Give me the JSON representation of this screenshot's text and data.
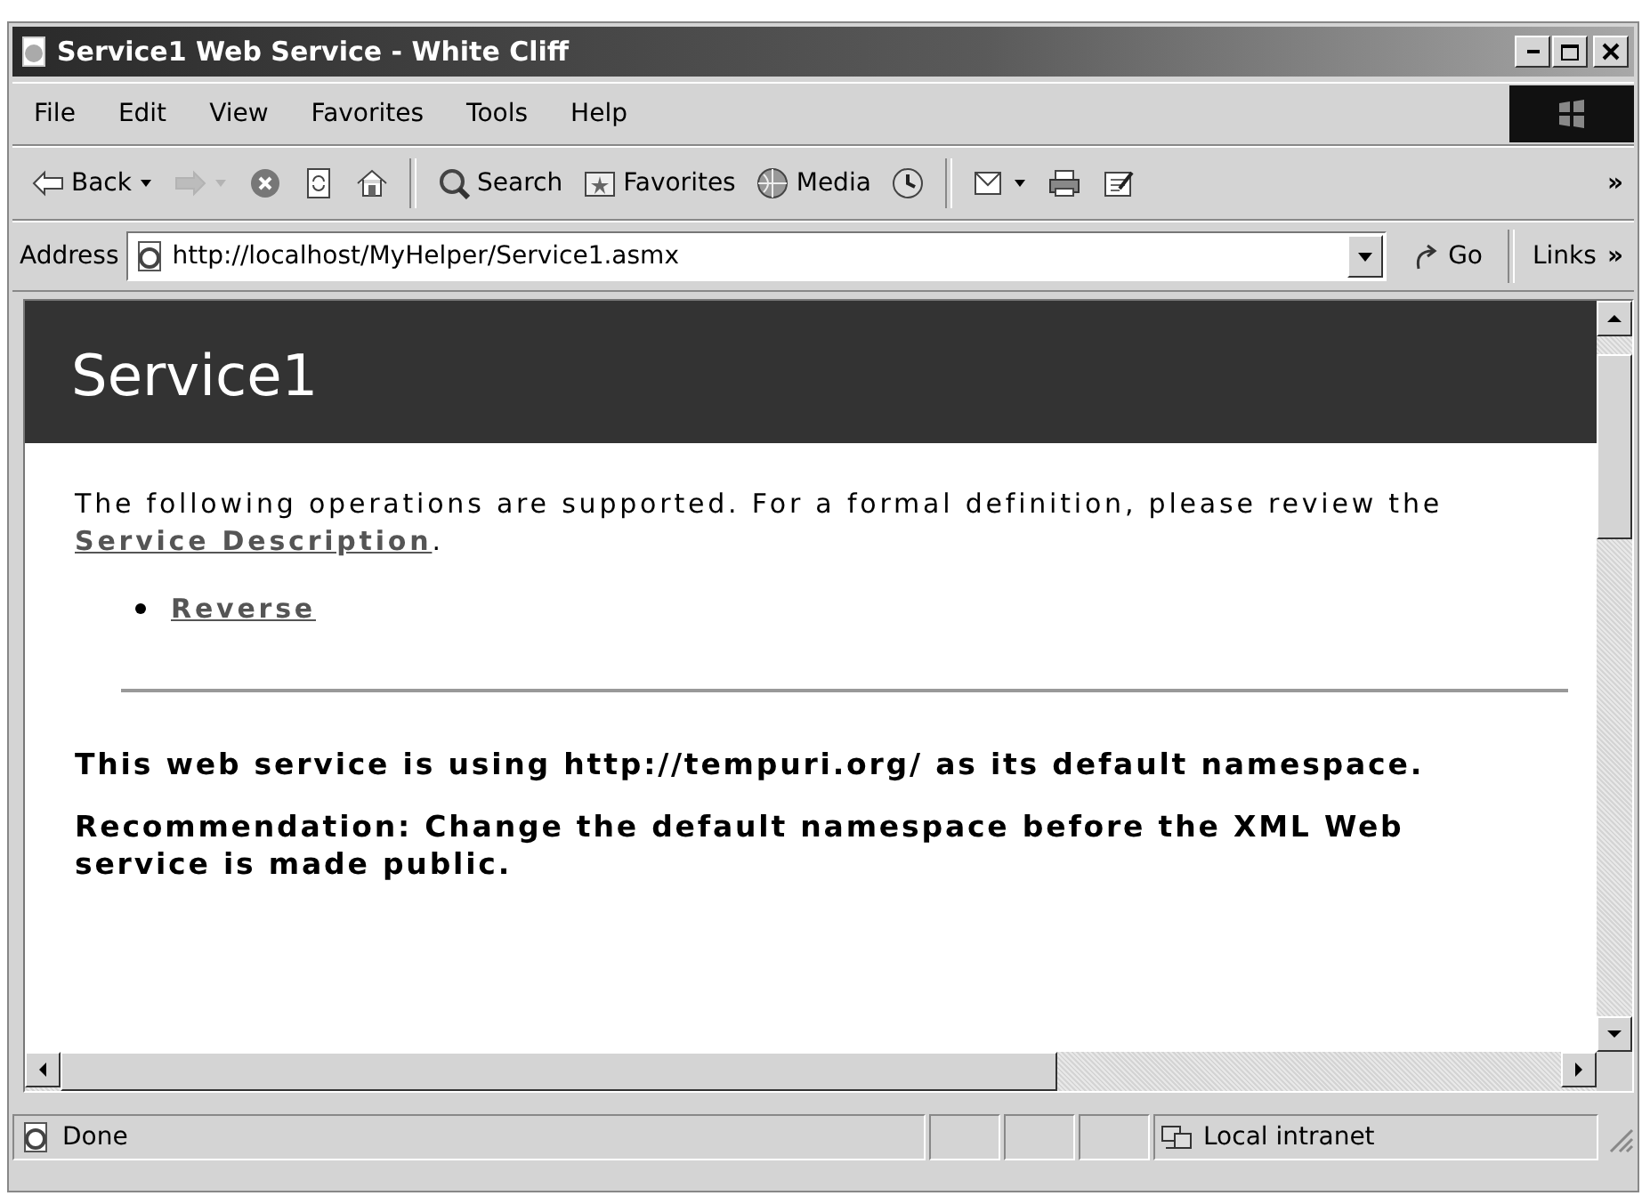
{
  "window": {
    "title": "Service1 Web Service - White Cliff"
  },
  "menu": [
    "File",
    "Edit",
    "View",
    "Favorites",
    "Tools",
    "Help"
  ],
  "toolbar": {
    "items": [
      {
        "kind": "back",
        "label": "Back",
        "disabled": false
      },
      {
        "kind": "forward",
        "disabled": true
      },
      {
        "kind": "stop",
        "disabled": false
      },
      {
        "kind": "refresh",
        "disabled": false
      },
      {
        "kind": "home",
        "disabled": false
      },
      {
        "kind": "separator"
      },
      {
        "kind": "search",
        "label": "Search",
        "disabled": false
      },
      {
        "kind": "favorites",
        "label": "Favorites",
        "disabled": false
      },
      {
        "kind": "media",
        "label": "Media",
        "disabled": false
      },
      {
        "kind": "history",
        "disabled": false
      },
      {
        "kind": "separator"
      },
      {
        "kind": "mail",
        "disabled": false
      },
      {
        "kind": "print",
        "disabled": false
      },
      {
        "kind": "edit",
        "disabled": false
      }
    ],
    "more": "»"
  },
  "address": {
    "label": "Address",
    "value": "http://localhost/MyHelper/Service1.asmx",
    "go": "Go",
    "links": "Links",
    "links_more": "»"
  },
  "page": {
    "heading": "Service1",
    "intro_before": "The following operations are supported. For a formal definition, please review the ",
    "intro_link": "Service Description",
    "intro_after": ".",
    "operations": [
      "Reverse"
    ],
    "notes": [
      "This web service is using http://tempuri.org/ as its default namespace.",
      "Recommendation: Change the default namespace before the XML Web service is made public."
    ]
  },
  "status": {
    "text": "Done",
    "zone": "Local intranet"
  }
}
